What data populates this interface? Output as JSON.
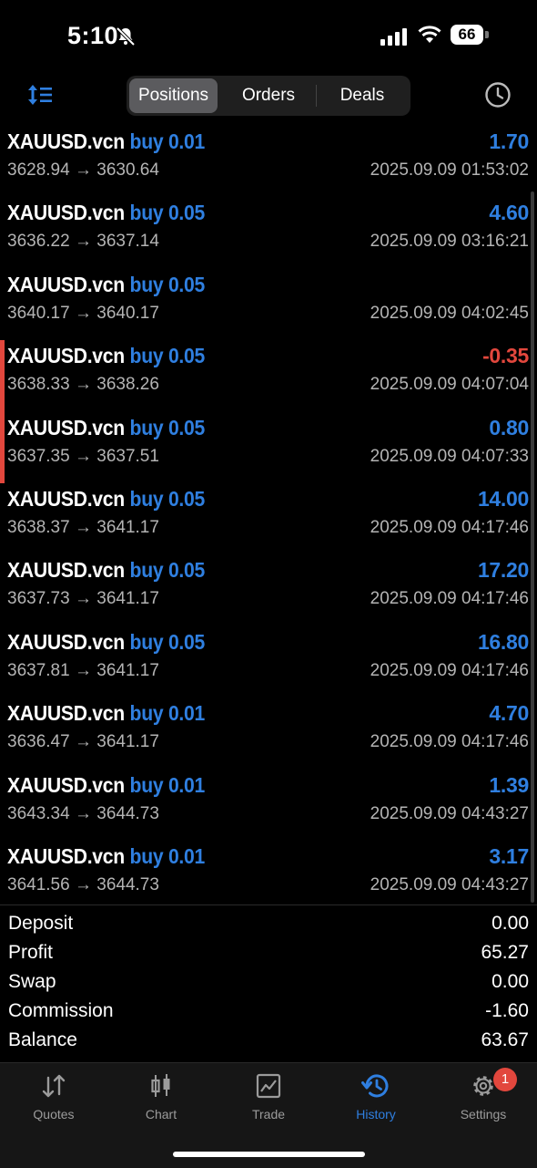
{
  "status_bar": {
    "time": "5:10",
    "battery": "66"
  },
  "tabs": [
    {
      "label": "Positions",
      "active": true
    },
    {
      "label": "Orders",
      "active": false
    },
    {
      "label": "Deals",
      "active": false
    }
  ],
  "positions": [
    {
      "symbol": "XAUUSD.vcn",
      "side": "buy 0.01",
      "profit": "1.70",
      "open": "3628.94",
      "close": "3630.64",
      "time": "2025.09.09 01:53:02"
    },
    {
      "symbol": "XAUUSD.vcn",
      "side": "buy 0.05",
      "profit": "4.60",
      "open": "3636.22",
      "close": "3637.14",
      "time": "2025.09.09 03:16:21"
    },
    {
      "symbol": "XAUUSD.vcn",
      "side": "buy 0.05",
      "profit": "",
      "open": "3640.17",
      "close": "3640.17",
      "time": "2025.09.09 04:02:45"
    },
    {
      "symbol": "XAUUSD.vcn",
      "side": "buy 0.05",
      "profit": "-0.35",
      "open": "3638.33",
      "close": "3638.26",
      "time": "2025.09.09 04:07:04"
    },
    {
      "symbol": "XAUUSD.vcn",
      "side": "buy 0.05",
      "profit": "0.80",
      "open": "3637.35",
      "close": "3637.51",
      "time": "2025.09.09 04:07:33"
    },
    {
      "symbol": "XAUUSD.vcn",
      "side": "buy 0.05",
      "profit": "14.00",
      "open": "3638.37",
      "close": "3641.17",
      "time": "2025.09.09 04:17:46"
    },
    {
      "symbol": "XAUUSD.vcn",
      "side": "buy 0.05",
      "profit": "17.20",
      "open": "3637.73",
      "close": "3641.17",
      "time": "2025.09.09 04:17:46"
    },
    {
      "symbol": "XAUUSD.vcn",
      "side": "buy 0.05",
      "profit": "16.80",
      "open": "3637.81",
      "close": "3641.17",
      "time": "2025.09.09 04:17:46"
    },
    {
      "symbol": "XAUUSD.vcn",
      "side": "buy 0.01",
      "profit": "4.70",
      "open": "3636.47",
      "close": "3641.17",
      "time": "2025.09.09 04:17:46"
    },
    {
      "symbol": "XAUUSD.vcn",
      "side": "buy 0.01",
      "profit": "1.39",
      "open": "3643.34",
      "close": "3644.73",
      "time": "2025.09.09 04:43:27"
    },
    {
      "symbol": "XAUUSD.vcn",
      "side": "buy 0.01",
      "profit": "3.17",
      "open": "3641.56",
      "close": "3644.73",
      "time": "2025.09.09 04:43:27"
    }
  ],
  "summary": {
    "deposit_label": "Deposit",
    "deposit": "0.00",
    "profit_label": "Profit",
    "profit": "65.27",
    "swap_label": "Swap",
    "swap": "0.00",
    "commission_label": "Commission",
    "commission": "-1.60",
    "balance_label": "Balance",
    "balance": "63.67"
  },
  "bottom_nav": [
    {
      "label": "Quotes",
      "icon": "quotes-arrows-icon"
    },
    {
      "label": "Chart",
      "icon": "candlestick-icon"
    },
    {
      "label": "Trade",
      "icon": "trade-chart-icon"
    },
    {
      "label": "History",
      "icon": "history-icon",
      "active": true
    },
    {
      "label": "Settings",
      "icon": "gear-icon",
      "badge": "1"
    }
  ],
  "colors": {
    "accent": "#2f7fe0",
    "negative": "#e2473d",
    "background": "#000000"
  }
}
